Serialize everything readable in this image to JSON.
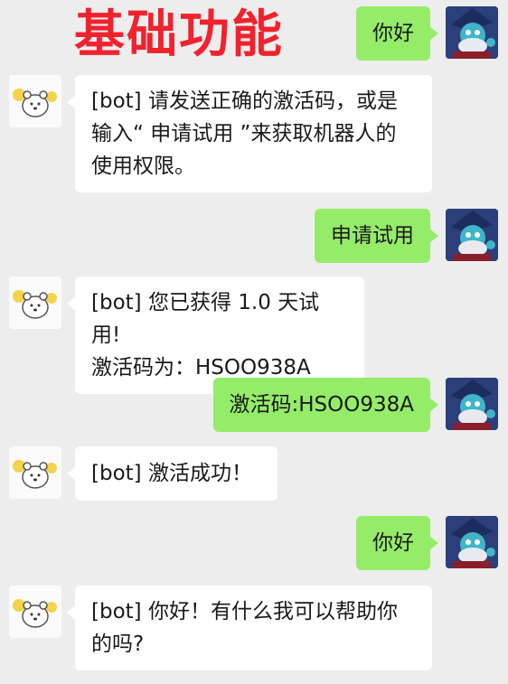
{
  "title": "基础功能",
  "messages": [
    {
      "sender": "user",
      "text": "你好"
    },
    {
      "sender": "bot",
      "text": "[bot] 请发送正确的激活码，或是输入“ 申请试用 ”来获取机器人的使用权限。"
    },
    {
      "sender": "user",
      "text": "申请试用"
    },
    {
      "sender": "bot",
      "line1": "[bot] 您已获得 1.0 天试用!",
      "line2": "激活码为：HSOO938A"
    },
    {
      "sender": "user",
      "text": "激活码:HSOO938A"
    },
    {
      "sender": "bot",
      "text": "[bot] 激活成功！"
    },
    {
      "sender": "user",
      "text": "你好"
    },
    {
      "sender": "bot",
      "text": "[bot] 你好！有什么我可以帮助你的吗?"
    }
  ],
  "avatars": {
    "user": "wizard-avatar-icon",
    "bot": "bear-avatar-icon"
  },
  "colors": {
    "title": "#f0222e",
    "user_bubble": "#95ec69",
    "bot_bubble": "#ffffff",
    "background": "#ededed"
  }
}
